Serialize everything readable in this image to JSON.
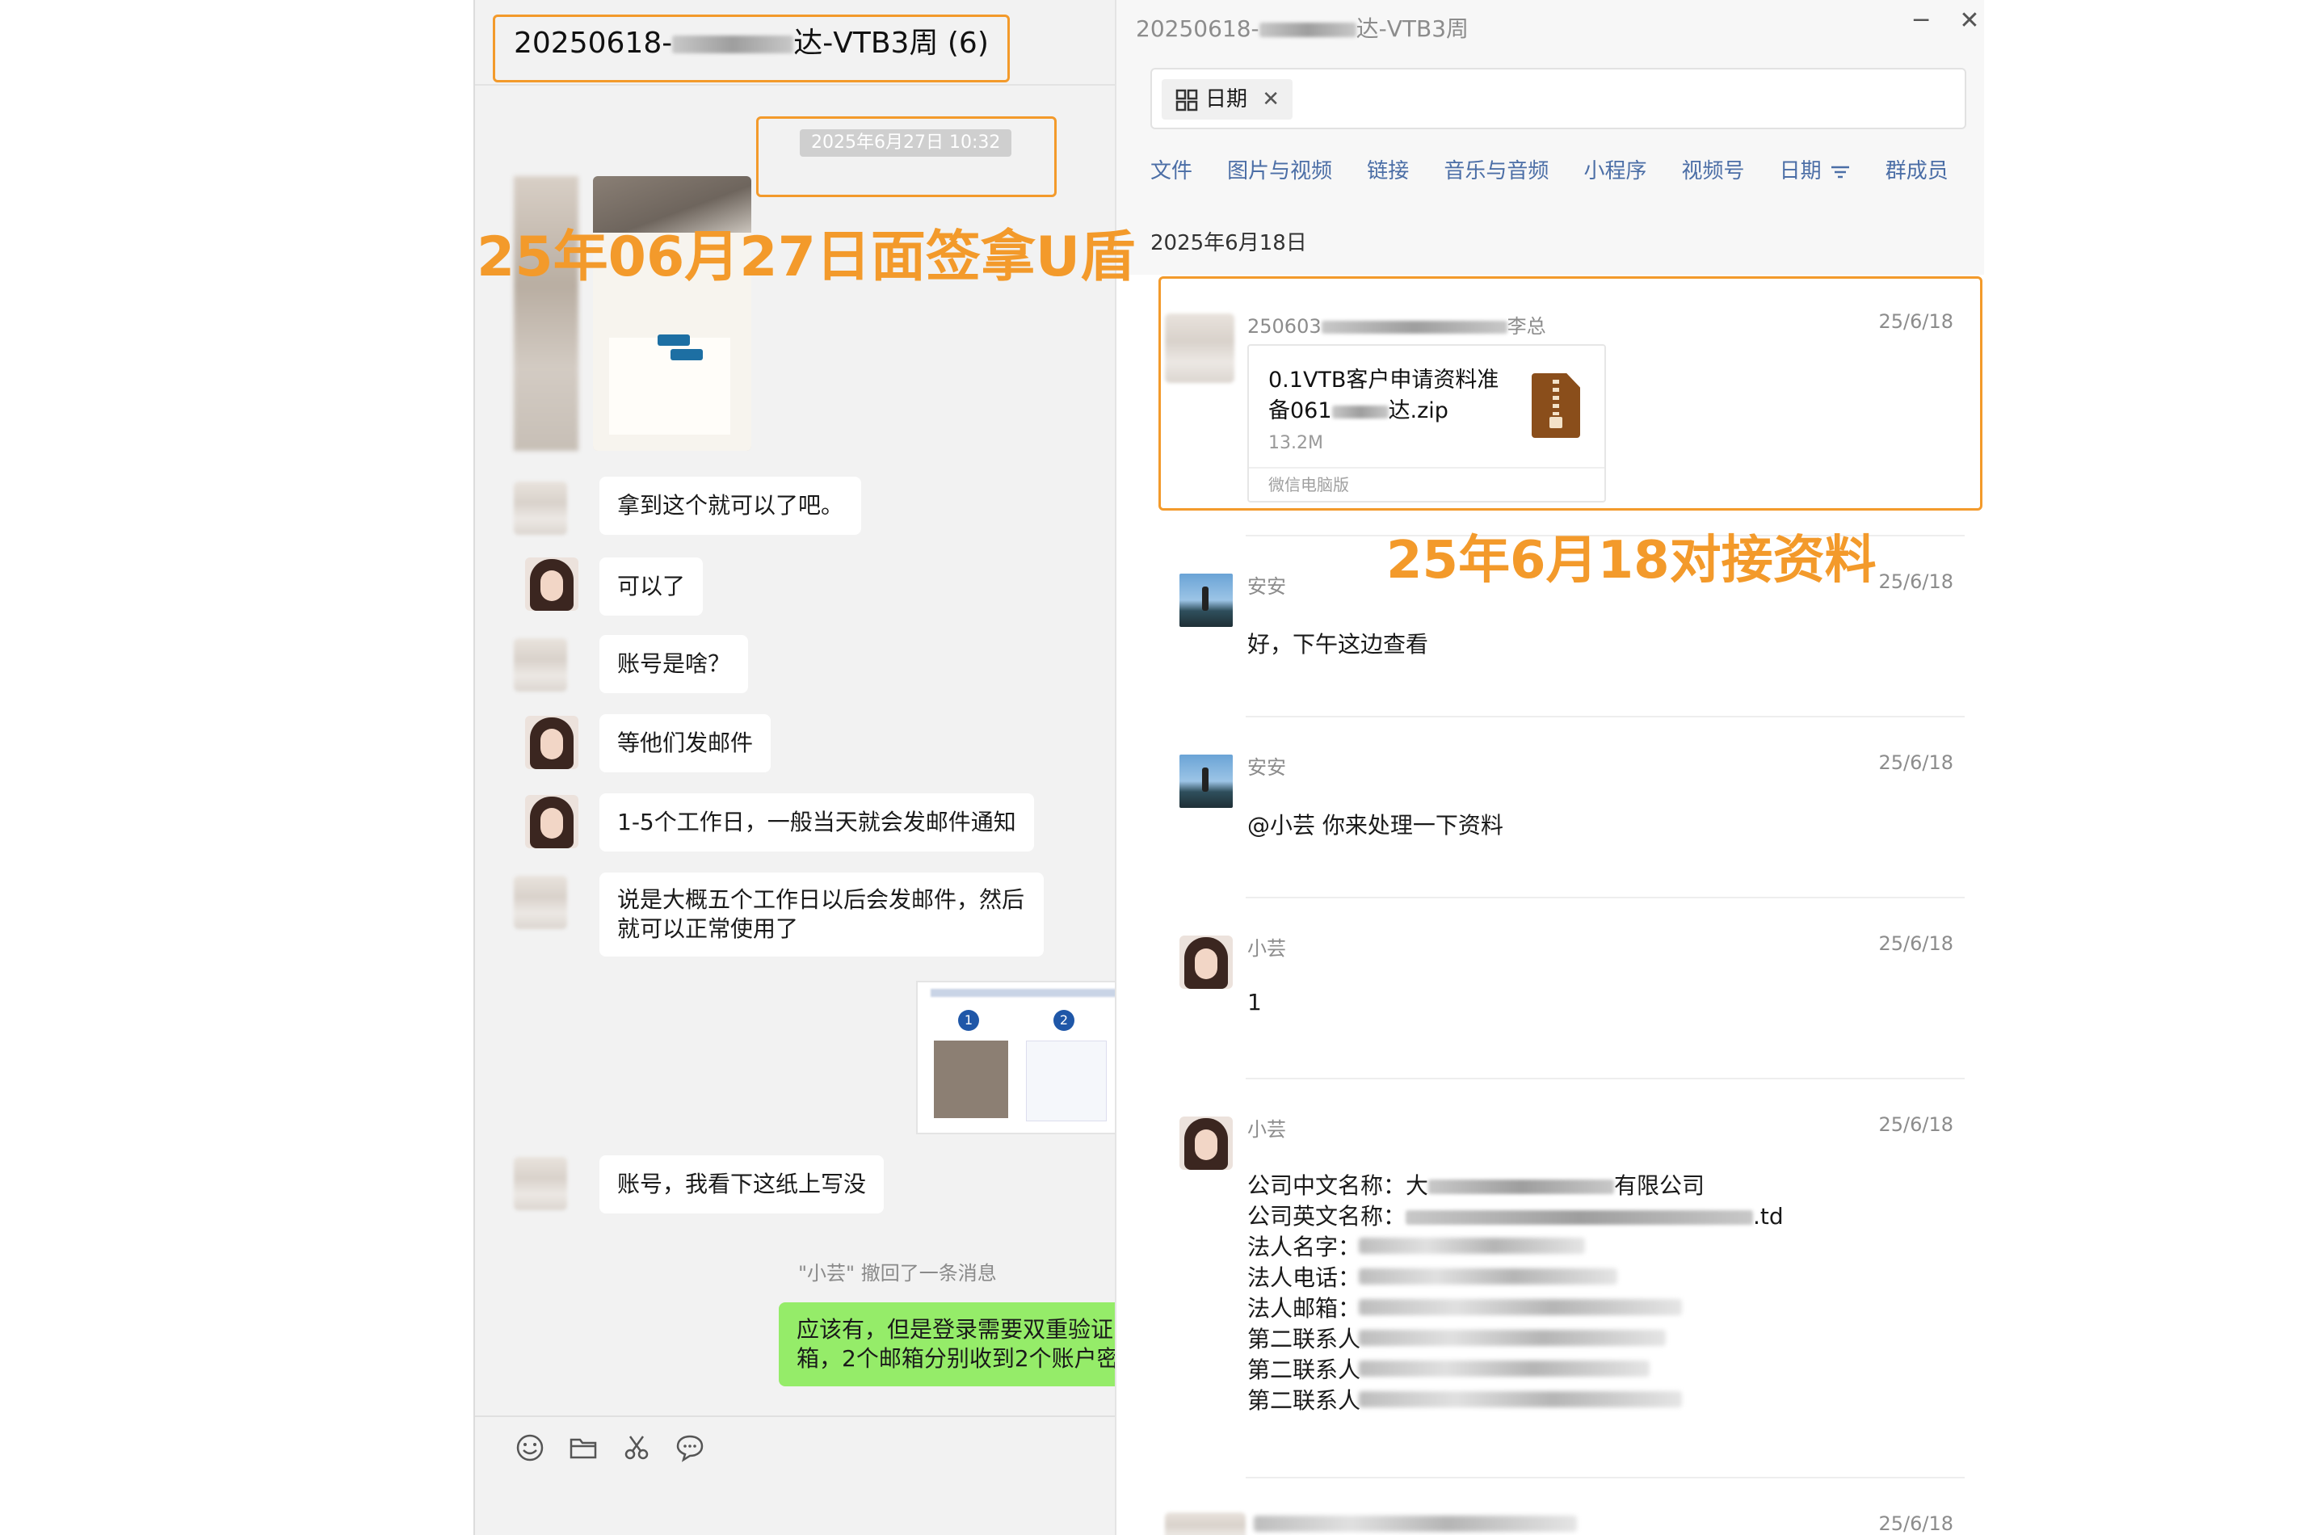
{
  "left_chat": {
    "title_prefix": "20250618-",
    "title_suffix": "达-VTB3周 (6)",
    "timestamp": "2025年6月27日 10:32",
    "messages": [
      "拿到这个就可以了吧。",
      "可以了",
      "账号是啥？",
      "等他们发邮件",
      "1-5个工作日，一般当天就会发邮件通知",
      "说是大概五个工作日以后会发邮件，然后就可以正常使用了",
      "账号，我看下这纸上写没"
    ],
    "recall_notice": "\"小芸\" 撤回了一条消息",
    "green_message": "应该有，但是登录需要双重验证箱，2个邮箱分别收到2个账户密",
    "toolbar_icons": [
      "emoji-icon",
      "folder-icon",
      "scissors-icon",
      "chat-bubble-icon"
    ]
  },
  "right_panel": {
    "window_title_prefix": "20250618-",
    "window_title_suffix": "达-VTB3周",
    "minimize": "─",
    "close": "✕",
    "filter_chip_label": "日期",
    "filter_chip_close": "✕",
    "tabs": [
      "文件",
      "图片与视频",
      "链接",
      "音乐与音频",
      "小程序",
      "视频号",
      "日期",
      "群成员"
    ],
    "section_date": "2025年6月18日",
    "file_message": {
      "sender_prefix": "250603",
      "sender_suffix": "李总",
      "date": "25/6/18",
      "file_name_line1": "0.1VTB客户申请资料准",
      "file_name_line2a": "备061",
      "file_name_line2b": "达.zip",
      "file_size": "13.2M",
      "source": "微信电脑版"
    },
    "messages": [
      {
        "sender": "安安",
        "date": "25/6/18",
        "text": "好，下午这边查看"
      },
      {
        "sender": "安安",
        "date": "25/6/18",
        "text": "@小芸 你来处理一下资料"
      },
      {
        "sender": "小芸",
        "date": "25/6/18",
        "text": "1"
      }
    ],
    "company_message": {
      "sender": "小芸",
      "date": "25/6/18",
      "line1_prefix": "公司中文名称：大",
      "line1_suffix": "有限公司",
      "line2_prefix": "公司英文名称：",
      "line2_suffix": ".td",
      "labels": [
        "法人名字：",
        "法人电话：",
        "法人邮箱：",
        "第二联系人",
        "第二联系人",
        "第二联系人"
      ]
    },
    "last_date": "25/6/18"
  },
  "annotations": {
    "left_label": "25年06月27日面签拿U盾",
    "right_label": "25年6月18对接资料",
    "color": "#f39a2b"
  }
}
